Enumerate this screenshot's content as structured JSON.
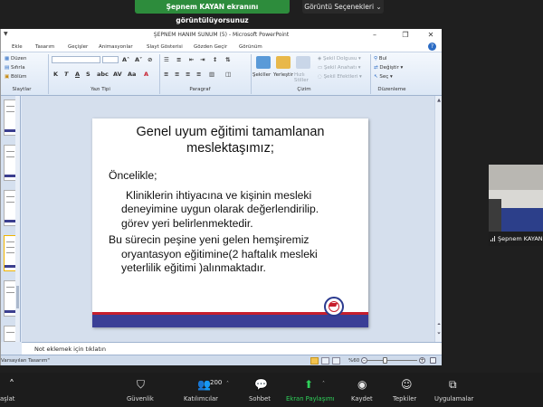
{
  "zoom": {
    "share_banner": "Şepnem KAYAN ekranını görüntülüyorsunuz",
    "view_options": "Görüntü Seçenekleri",
    "toolbar": {
      "start_label": "aşlat",
      "security_label": "Güvenlik",
      "participants_label": "Katılımcılar",
      "participants_count": "200",
      "chat_label": "Sohbet",
      "screen_share_label": "Ekran Paylaşımı",
      "record_label": "Kaydet",
      "reactions_label": "Tepkiler",
      "apps_label": "Uygulamalar"
    },
    "video": {
      "participant_name": "Şepnem KAYAN"
    }
  },
  "powerpoint": {
    "window_title": "ŞEPNEM HANIM SUNUM (5) - Microsoft PowerPoint",
    "tabs": [
      "Ekle",
      "Tasarım",
      "Geçişler",
      "Animasyonlar",
      "Slayt Gösterisi",
      "Gözden Geçir",
      "Görünüm"
    ],
    "ribbon": {
      "groups": {
        "slides": "Slaytlar",
        "font": "Yazı Tipi",
        "paragraph": "Paragraf",
        "drawing": "Çizim",
        "editing": "Düzenleme"
      },
      "slides": {
        "layout": "Düzen",
        "reset": "Sıfırla",
        "section": "Bölüm"
      },
      "drawing": {
        "shapes": "Şekiller",
        "arrange": "Yerleştir",
        "quick_styles": "Hızlı Stiller",
        "shape_fill": "Şekil Dolgusu",
        "shape_outline": "Şekil Anahatı",
        "shape_effects": "Şekil Efektleri"
      },
      "editing": {
        "find": "Bul",
        "replace": "Değiştir",
        "select": "Seç"
      }
    },
    "slide": {
      "title_line1": "Genel uyum eğitimi tamamlanan",
      "title_line2": "meslektaşımız;",
      "body": [
        "Öncelikle;",
        "Kliniklerin ihtiyacına    ve kişinin mesleki",
        "deneyimine uygun olarak değerlendirilip.",
        "görev yeri belirlenmektedir.",
        "Bu sürecin peşine yeni gelen hemşiremiz",
        "oryantasyon  eğitimine(2 haftalık mesleki",
        "yeterlilik eğitimi )alınmaktadır."
      ]
    },
    "notes_placeholder": "Not eklemek için tıklatın",
    "status": {
      "theme": "Varsayılan Tasarım\"",
      "zoom": "%60"
    }
  },
  "colors": {
    "zoom_green": "#2d8c3c",
    "slide_red": "#c71f2d",
    "slide_blue": "#3a3f96"
  }
}
